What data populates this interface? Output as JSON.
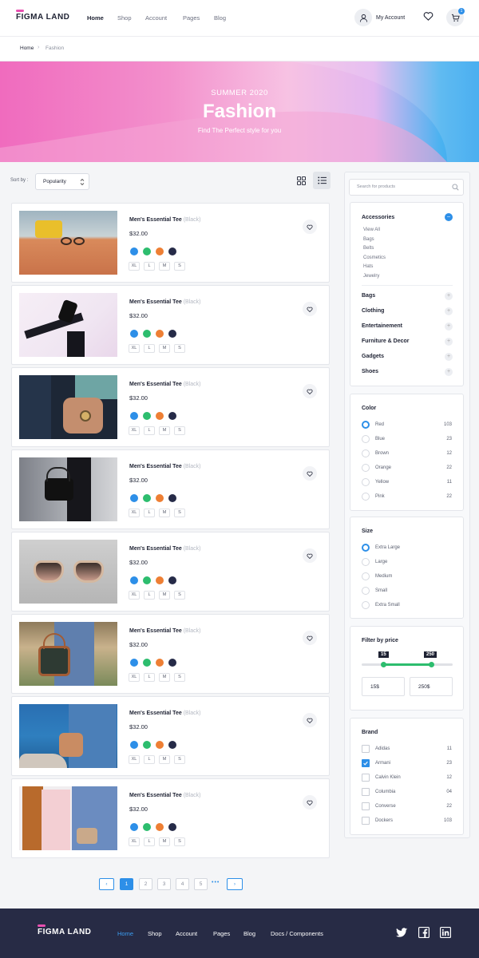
{
  "header": {
    "logo": "FIGMA LAND",
    "nav": [
      "Home",
      "Shop",
      "Account",
      "Pages",
      "Blog"
    ],
    "account_label": "My Account",
    "cart_count": "1"
  },
  "breadcrumb": {
    "items": [
      "Home",
      "Fashion"
    ]
  },
  "hero": {
    "kicker": "SUMMER 2020",
    "title": "Fashion",
    "subtitle": "Find The Perfect style for you"
  },
  "sort": {
    "label": "Sort by :",
    "value": "Popularity"
  },
  "product_template": {
    "name": "Men's Essential Tee",
    "variant": "(Black)",
    "price": "$32.00",
    "sizes": [
      "XL",
      "L",
      "M",
      "S"
    ],
    "colors": [
      "#2d8fe8",
      "#2dbd6e",
      "#ee7f34",
      "#262b48"
    ]
  },
  "products": [
    {
      "name": "Men's Essential Tee",
      "variant": "(Black)",
      "price": "$32.00",
      "image": "yellow-bag-sunglasses"
    },
    {
      "name": "Men's Essential Tee",
      "variant": "(Black)",
      "price": "$32.00",
      "image": "black-sneakers"
    },
    {
      "name": "Men's Essential Tee",
      "variant": "(Black)",
      "price": "$32.00",
      "image": "wrist-watch"
    },
    {
      "name": "Men's Essential Tee",
      "variant": "(Black)",
      "price": "$32.00",
      "image": "black-handbag"
    },
    {
      "name": "Men's Essential Tee",
      "variant": "(Black)",
      "price": "$32.00",
      "image": "sunglasses"
    },
    {
      "name": "Men's Essential Tee",
      "variant": "(Black)",
      "price": "$32.00",
      "image": "leather-handbag"
    },
    {
      "name": "Men's Essential Tee",
      "variant": "(Black)",
      "price": "$32.00",
      "image": "seaside-crossbody-bag"
    },
    {
      "name": "Men's Essential Tee",
      "variant": "(Black)",
      "price": "$32.00",
      "image": "jacket-wardrobe"
    }
  ],
  "sidebar": {
    "search_placeholder": "Search for products",
    "accessories": {
      "title": "Accessories",
      "items": [
        "View All",
        "Bags",
        "Belts",
        "Cosmetics",
        "Hats",
        "Jewelry"
      ]
    },
    "categories": [
      "Bags",
      "Clothing",
      "Entertainement",
      "Furniture & Decor",
      "Gadgets",
      "Shoes"
    ],
    "color": {
      "title": "Color",
      "options": [
        {
          "label": "Red",
          "count": "103",
          "selected": true
        },
        {
          "label": "Blue",
          "count": "23"
        },
        {
          "label": "Brown",
          "count": "12"
        },
        {
          "label": "Orange",
          "count": "22"
        },
        {
          "label": "Yellow",
          "count": "11"
        },
        {
          "label": "Pink",
          "count": "22"
        }
      ]
    },
    "size": {
      "title": "Size",
      "options": [
        "Extra Large",
        "Large",
        "Medium",
        "Small",
        "Extra Small"
      ],
      "selected": "Extra Large"
    },
    "price": {
      "title": "Filter by price",
      "min": "15",
      "max": "250",
      "min_input": "15$",
      "max_input": "250$"
    },
    "brand": {
      "title": "Brand",
      "options": [
        {
          "label": "Adidas",
          "count": "11"
        },
        {
          "label": "Armani",
          "count": "23",
          "checked": true
        },
        {
          "label": "Calvin Klein",
          "count": "12"
        },
        {
          "label": "Columbia",
          "count": "04"
        },
        {
          "label": "Converse",
          "count": "22"
        },
        {
          "label": "Dockers",
          "count": "103"
        }
      ]
    }
  },
  "pagination": {
    "pages": [
      "1",
      "2",
      "3",
      "4",
      "5"
    ],
    "current": "1",
    "ellipsis": "•••"
  },
  "footer": {
    "logo": "FIGMA LAND",
    "nav": [
      "Home",
      "Shop",
      "Account",
      "Pages",
      "Blog",
      "Docs / Components"
    ],
    "social": [
      "twitter-icon",
      "facebook-icon",
      "linkedin-icon"
    ]
  },
  "colors": {
    "accent": "#2d8fe8",
    "footer_bg": "#272b45",
    "brand_pink": "#e84fb0"
  }
}
